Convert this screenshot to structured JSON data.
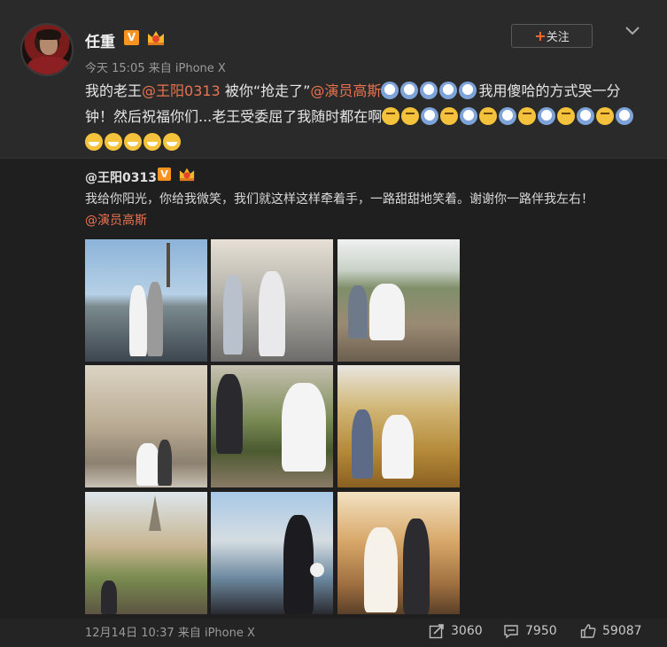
{
  "author": {
    "name": "任重",
    "verified_label": "V",
    "time": "今天 15:05",
    "source": "来自 iPhone X",
    "follow_label": "关注"
  },
  "post": {
    "segments": [
      {
        "t": "我的老王",
        "k": "text"
      },
      {
        "t": "@王阳0313",
        "k": "mention"
      },
      {
        "t": " 被你“抢走了”",
        "k": "text"
      },
      {
        "t": "@演员高斯",
        "k": "mention"
      },
      {
        "t": "sad",
        "k": "emo"
      },
      {
        "t": "sad",
        "k": "emo"
      },
      {
        "t": "sad",
        "k": "emo"
      },
      {
        "t": "sad",
        "k": "emo"
      },
      {
        "t": "sad",
        "k": "emo"
      },
      {
        "t": "我用傻哈的方式哭一分钟！然后祝福你们...老王受委屈了我随时都在啊",
        "k": "text"
      },
      {
        "t": "smile",
        "k": "emo"
      },
      {
        "t": "smile",
        "k": "emo"
      },
      {
        "t": "sad",
        "k": "emo"
      },
      {
        "t": "smile",
        "k": "emo"
      },
      {
        "t": "sad",
        "k": "emo"
      },
      {
        "t": "smile",
        "k": "emo"
      },
      {
        "t": "sad",
        "k": "emo"
      },
      {
        "t": "smile",
        "k": "emo"
      },
      {
        "t": "sad",
        "k": "emo"
      },
      {
        "t": "smile",
        "k": "emo"
      },
      {
        "t": "sad",
        "k": "emo"
      },
      {
        "t": "smile",
        "k": "emo"
      },
      {
        "t": "sad",
        "k": "emo"
      },
      {
        "t": "grin",
        "k": "emo"
      },
      {
        "t": "grin",
        "k": "emo"
      },
      {
        "t": "grin",
        "k": "emo"
      },
      {
        "t": "grin",
        "k": "emo"
      },
      {
        "t": "grin",
        "k": "emo"
      }
    ]
  },
  "repost": {
    "author": "@王阳0313",
    "verified_label": "V",
    "text": "我给你阳光，你给我微笑，我们就这样这样牵着手，一路甜甜地笑着。谢谢你一路伴我左右！",
    "mention": "@演员高斯",
    "photos": [
      "p1",
      "p2",
      "p3",
      "p4",
      "p5",
      "p6",
      "p7",
      "p8",
      "p9"
    ]
  },
  "footer": {
    "time": "12月14日 10:37",
    "source": "来自 iPhone X",
    "shares": "3060",
    "comments": "7950",
    "likes": "59087"
  },
  "colors": {
    "mention": "#eb7350",
    "background": "#2a2a2a",
    "repost_background": "#1f1f1f",
    "verified": "#f7931e"
  },
  "icons": [
    "chevron-down-icon",
    "share-icon",
    "comment-icon",
    "like-icon",
    "vip-crown-icon",
    "verified-v-icon"
  ]
}
